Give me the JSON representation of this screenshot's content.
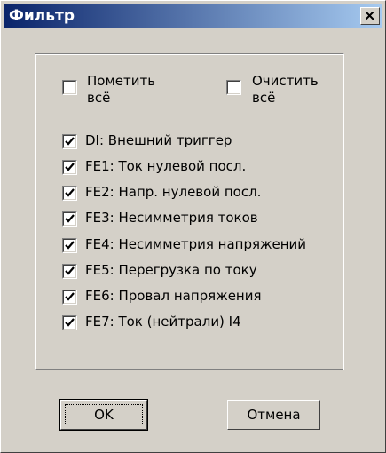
{
  "window": {
    "title": "Фильтр",
    "close_label": "X"
  },
  "mark_all_label": "Пометить\nвсё",
  "clear_all_label": "Очистить\nвсё",
  "filters": [
    {
      "label": "DI:  Внешний триггер",
      "checked": true
    },
    {
      "label": "FE1: Ток нулевой посл.",
      "checked": true
    },
    {
      "label": "FE2: Напр. нулевой посл.",
      "checked": true
    },
    {
      "label": "FE3: Несимметрия токов",
      "checked": true
    },
    {
      "label": "FE4: Несимметрия напряжений",
      "checked": true
    },
    {
      "label": "FE5: Перегрузка по току",
      "checked": true
    },
    {
      "label": "FE6: Провал напряжения",
      "checked": true
    },
    {
      "label": "FE7: Ток (нейтрали) I4",
      "checked": true
    }
  ],
  "buttons": {
    "ok": "OK",
    "cancel": "Отмена"
  }
}
